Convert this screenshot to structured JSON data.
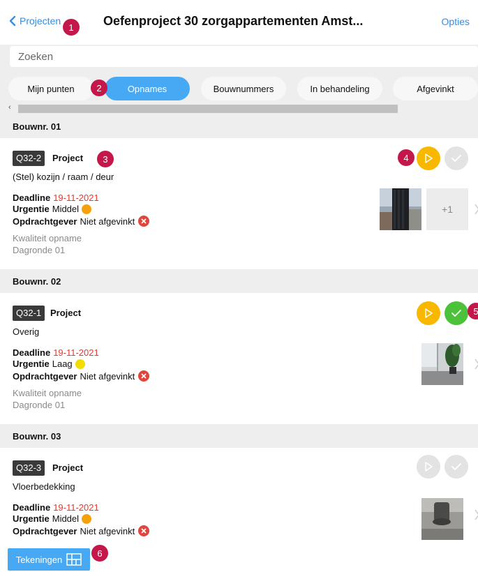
{
  "header": {
    "back_label": "Projecten",
    "title": "Oefenproject 30 zorgappartementen Amst...",
    "options_label": "Opties"
  },
  "search": {
    "placeholder": "Zoeken"
  },
  "tabs": [
    {
      "label": "Mijn punten",
      "active": false
    },
    {
      "label": "Opnames",
      "active": true
    },
    {
      "label": "Bouwnummers",
      "active": false
    },
    {
      "label": "In behandeling",
      "active": false
    },
    {
      "label": "Afgevinkt",
      "active": false
    }
  ],
  "scroll_arrow": "‹",
  "labels": {
    "deadline": "Deadline",
    "urgentie": "Urgentie",
    "opdrachtgever": "Opdrachtgever"
  },
  "sections": [
    {
      "heading": "Bouwnr. 01",
      "code": "Q32-2",
      "type": "Project",
      "subtitle": "(Stel) kozijn / raam / deur",
      "deadline": "19-11-2021",
      "urgency": "Middel",
      "urgency_color": "#f5a10c",
      "client_status": "Niet afgevinkt",
      "category": "Kwaliteit opname",
      "round": "Dagronde 01",
      "extra_photos": "+1"
    },
    {
      "heading": "Bouwnr. 02",
      "code": "Q32-1",
      "type": "Project",
      "subtitle": "Overig",
      "deadline": "19-11-2021",
      "urgency": "Laag",
      "urgency_color": "#f3dd00",
      "client_status": "Niet afgevinkt",
      "category": "Kwaliteit opname",
      "round": "Dagronde 01"
    },
    {
      "heading": "Bouwnr. 03",
      "code": "Q32-3",
      "type": "Project",
      "subtitle": "Vloerbedekking",
      "deadline": "19-11-2021",
      "urgency": "Middel",
      "urgency_color": "#f5a10c",
      "client_status": "Niet afgevinkt"
    }
  ],
  "badges": [
    "1",
    "2",
    "3",
    "4",
    "5",
    "6"
  ],
  "bottom": {
    "drawings_label": "Tekeningen"
  },
  "colors": {
    "accent": "#47a9f3",
    "link": "#2f8fe8",
    "start_active": "#f9b800",
    "check_active": "#4cc13a",
    "disabled": "#e3e3e3",
    "deadline": "#e23a2e",
    "badge": "#c4174a"
  },
  "icons": [
    "chevron-left-icon",
    "play-icon",
    "check-icon",
    "x-circle-icon",
    "chevron-right-icon",
    "drawing-grid-icon"
  ]
}
